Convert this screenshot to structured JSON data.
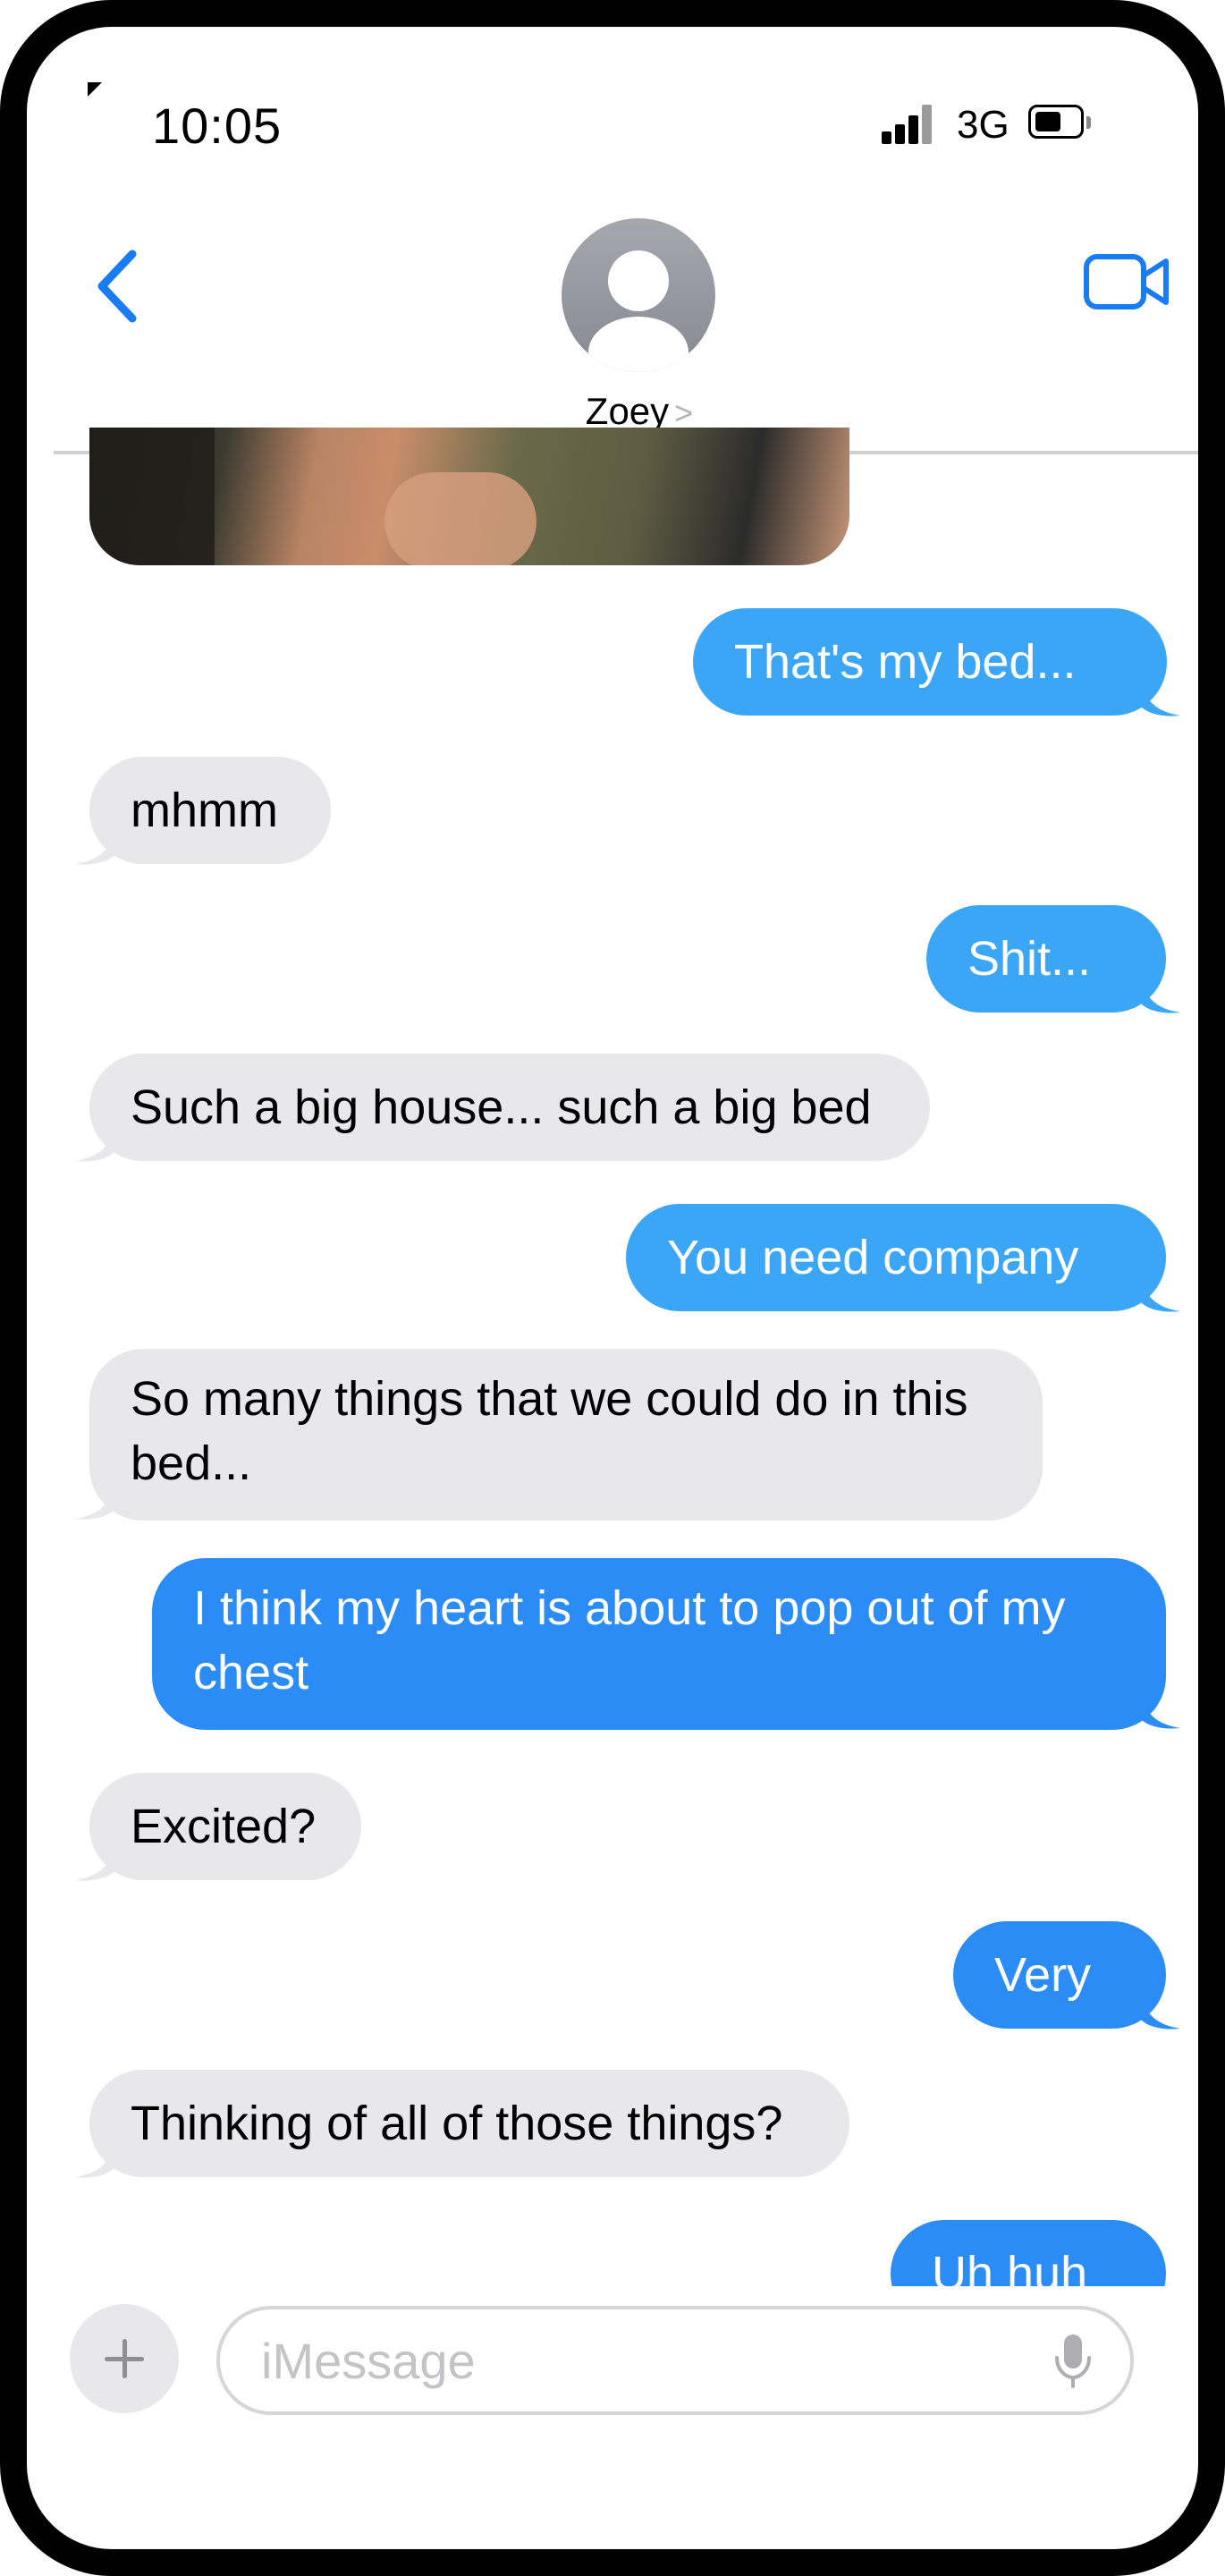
{
  "status_bar": {
    "time": "10:05",
    "network": "3G"
  },
  "header": {
    "contact_name": "Zoey",
    "chevron": ">"
  },
  "messages": [
    {
      "from": "me",
      "text": "That's my bed..."
    },
    {
      "from": "them",
      "text": "mhmm"
    },
    {
      "from": "me",
      "text": "Shit..."
    },
    {
      "from": "them",
      "text": "Such a big house... such a big bed"
    },
    {
      "from": "me",
      "text": "You need company"
    },
    {
      "from": "them",
      "text": "So many things that we could do in this bed..."
    },
    {
      "from": "me",
      "text": "I think my heart is about to pop out of my chest"
    },
    {
      "from": "them",
      "text": "Excited?"
    },
    {
      "from": "me",
      "text": "Very"
    },
    {
      "from": "them",
      "text": "Thinking of all of those things?"
    },
    {
      "from": "me",
      "text": "Uh huh"
    }
  ],
  "composer": {
    "placeholder": "iMessage"
  },
  "colors": {
    "accent": "#1a7cf2",
    "sent_bubble_light": "#3ca6f6",
    "sent_bubble_deep": "#2a8cf4",
    "received_bubble": "#e8e8ea"
  },
  "icons": [
    "back-chevron-icon",
    "contact-avatar-icon",
    "video-call-icon",
    "plus-icon",
    "microphone-icon",
    "signal-icon",
    "battery-icon"
  ]
}
